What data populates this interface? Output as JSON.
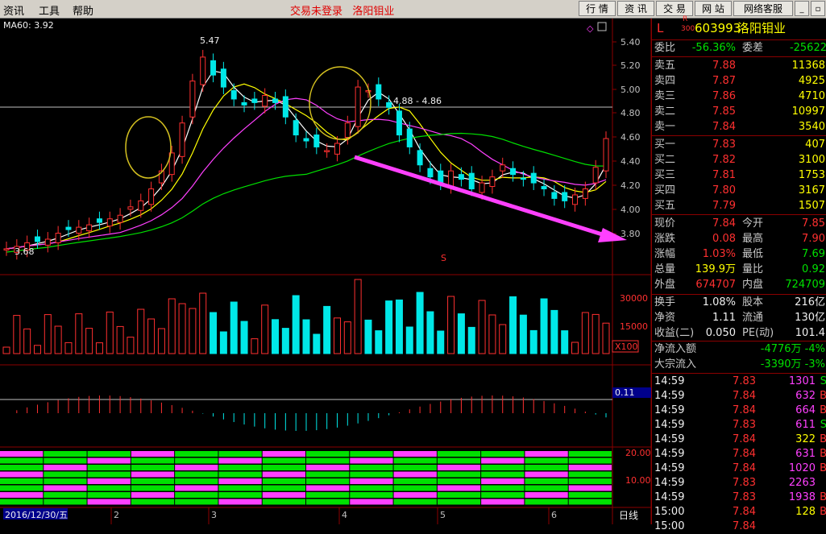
{
  "menubar": {
    "items": [
      "资讯",
      "工具",
      "帮助"
    ],
    "title_login": "交易未登录",
    "title_stock": "洛阳钼业",
    "buttons": [
      "行 情",
      "资 讯",
      "交 易",
      "网 站",
      "网络客服"
    ]
  },
  "chart": {
    "ma_label": "MA60: 3.92",
    "price_ticks": [
      "5.40",
      "5.20",
      "5.00",
      "4.80",
      "4.60",
      "4.40",
      "4.20",
      "4.00",
      "3.80"
    ],
    "high_label": "5.47",
    "low_label": "3.68",
    "range_label": "4.88 - 4.86",
    "s_mark": "S",
    "vol_ticks": [
      "30000",
      "15000"
    ],
    "vol_unit": "X100",
    "macd_value": "0.11",
    "ind_ticks": [
      "20.00",
      "10.00"
    ],
    "date_label": "2016/12/30/五",
    "month_labels": [
      "2",
      "3",
      "4",
      "5",
      "6"
    ],
    "period": "日线",
    "colors": {
      "up": "#ff3030",
      "down": "#00e8e8",
      "ma5": "#ffffff",
      "ma10": "#ffff00",
      "ma20": "#ff40ff",
      "ma60": "#00e000",
      "arrow": "#ff40ff",
      "circle": "#d4c020"
    },
    "price_range": [
      3.6,
      5.5
    ]
  },
  "chart_data": {
    "type": "candlestick",
    "ma60": 3.92,
    "high": 5.47,
    "low": 3.68
  },
  "quote": {
    "code": "603993",
    "name": "洛阳钼业",
    "market_tag": "L",
    "r_tag": "R",
    "r_sub": "300",
    "weibi_label": "委比",
    "weibi": "-56.36%",
    "weicha_label": "委差",
    "weicha": "-25622",
    "asks": [
      {
        "label": "卖五",
        "price": "7.88",
        "vol": "11368"
      },
      {
        "label": "卖四",
        "price": "7.87",
        "vol": "4925"
      },
      {
        "label": "卖三",
        "price": "7.86",
        "vol": "4710"
      },
      {
        "label": "卖二",
        "price": "7.85",
        "vol": "10997"
      },
      {
        "label": "卖一",
        "price": "7.84",
        "vol": "3540"
      }
    ],
    "bids": [
      {
        "label": "买一",
        "price": "7.83",
        "vol": "407"
      },
      {
        "label": "买二",
        "price": "7.82",
        "vol": "3100"
      },
      {
        "label": "买三",
        "price": "7.81",
        "vol": "1753"
      },
      {
        "label": "买四",
        "price": "7.80",
        "vol": "3167"
      },
      {
        "label": "买五",
        "price": "7.79",
        "vol": "1507"
      }
    ],
    "stats": [
      {
        "l1": "现价",
        "v1": "7.84",
        "c1": "red",
        "l2": "今开",
        "v2": "7.85",
        "c2": "red"
      },
      {
        "l1": "涨跌",
        "v1": "0.08",
        "c1": "red",
        "l2": "最高",
        "v2": "7.90",
        "c2": "red"
      },
      {
        "l1": "涨幅",
        "v1": "1.03%",
        "c1": "red",
        "l2": "最低",
        "v2": "7.69",
        "c2": "green"
      },
      {
        "l1": "总量",
        "v1": "139.9万",
        "c1": "yellow",
        "l2": "量比",
        "v2": "0.92",
        "c2": "green"
      },
      {
        "l1": "外盘",
        "v1": "674707",
        "c1": "red",
        "l2": "内盘",
        "v2": "724709",
        "c2": "green"
      }
    ],
    "fund": [
      {
        "l1": "换手",
        "v1": "1.08%",
        "l2": "股本",
        "v2": "216亿"
      },
      {
        "l1": "净资",
        "v1": "1.11",
        "l2": "流通",
        "v2": "130亿"
      },
      {
        "l1": "收益(二)",
        "v1": "0.050",
        "l2": "PE(动)",
        "v2": "101.4"
      }
    ],
    "flow": [
      {
        "label": "净流入额",
        "val": "-4776万",
        "pct": "-4%"
      },
      {
        "label": "大宗流入",
        "val": "-3390万",
        "pct": "-3%"
      }
    ],
    "ticks": [
      {
        "t": "14:59",
        "p": "7.83",
        "v": "1301",
        "s": "S",
        "vc": "magenta"
      },
      {
        "t": "14:59",
        "p": "7.84",
        "v": "632",
        "s": "B",
        "vc": "magenta"
      },
      {
        "t": "14:59",
        "p": "7.84",
        "v": "664",
        "s": "B",
        "vc": "magenta"
      },
      {
        "t": "14:59",
        "p": "7.83",
        "v": "611",
        "s": "S",
        "vc": "magenta"
      },
      {
        "t": "14:59",
        "p": "7.84",
        "v": "322",
        "s": "B",
        "vc": "yellow"
      },
      {
        "t": "14:59",
        "p": "7.84",
        "v": "631",
        "s": "B",
        "vc": "magenta"
      },
      {
        "t": "14:59",
        "p": "7.84",
        "v": "1020",
        "s": "B",
        "vc": "magenta"
      },
      {
        "t": "14:59",
        "p": "7.83",
        "v": "2263",
        "s": "",
        "vc": "magenta"
      },
      {
        "t": "14:59",
        "p": "7.83",
        "v": "1938",
        "s": "B",
        "vc": "magenta"
      },
      {
        "t": "15:00",
        "p": "7.84",
        "v": "128",
        "s": "B",
        "vc": "yellow"
      },
      {
        "t": "15:00",
        "p": "7.84",
        "v": "",
        "s": "",
        "vc": "magenta"
      }
    ]
  }
}
